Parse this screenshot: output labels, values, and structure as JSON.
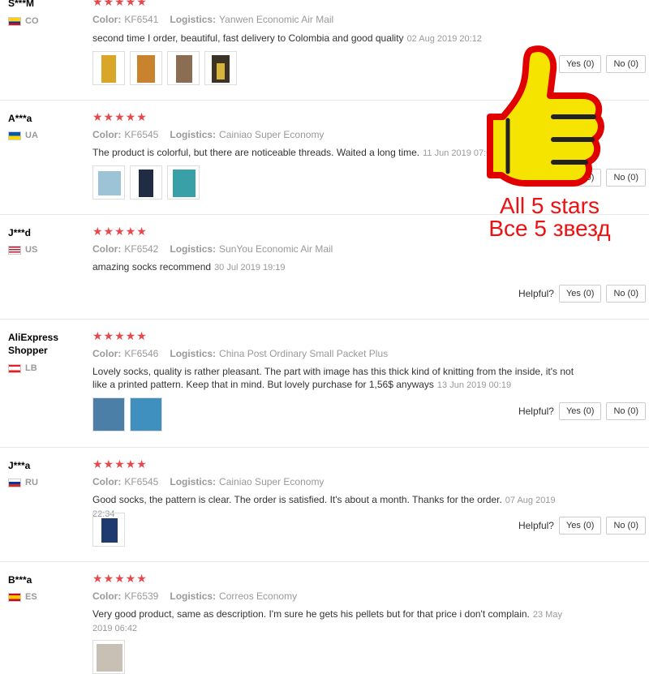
{
  "labels": {
    "color": "Color:",
    "logistics": "Logistics:",
    "helpful": "Helpful?"
  },
  "reviews": [
    {
      "user": "S***M",
      "country": "CO",
      "color_code": "KF6541",
      "logistics": "Yanwen Economic Air Mail",
      "text": "second time I order, beautiful, fast delivery to Colombia and good quality",
      "date": "02 Aug 2019 20:12",
      "yes": "Yes (0)",
      "no": "No (0)",
      "stars": "★★★★★"
    },
    {
      "user": "A***a",
      "country": "UA",
      "color_code": "KF6545",
      "logistics": "Cainiao Super Economy",
      "text": "The product is colorful, but there are noticeable threads. Waited a long time.",
      "date": "11 Jun 2019 07:03",
      "yes": "Yes (0)",
      "no": "No (0)",
      "stars": "★★★★★"
    },
    {
      "user": "J***d",
      "country": "US",
      "color_code": "KF6542",
      "logistics": "SunYou Economic Air Mail",
      "text": "amazing socks recommend",
      "date": "30 Jul 2019 19:19",
      "yes": "Yes (0)",
      "no": "No (0)",
      "stars": "★★★★★"
    },
    {
      "user": "AliExpress Shopper",
      "country": "LB",
      "color_code": "KF6546",
      "logistics": "China Post Ordinary Small Packet Plus",
      "text": "Lovely socks, quality is rather pleasant. The part with image has this thick kind of knitting from the inside, it's not like a printed pattern. Keep that in mind. But lovely purchase for 1,56$ anyways",
      "date": "13 Jun 2019 00:19",
      "yes": "Yes (0)",
      "no": "No (0)",
      "stars": "★★★★★"
    },
    {
      "user": "J***a",
      "country": "RU",
      "color_code": "KF6545",
      "logistics": "Cainiao Super Economy",
      "text": "Good socks, the pattern is clear. The order is satisfied. It's about a month. Thanks for the order.",
      "date": "07 Aug 2019 22:34",
      "yes": "Yes (0)",
      "no": "No (0)",
      "stars": "★★★★★"
    },
    {
      "user": "B***a",
      "country": "ES",
      "color_code": "KF6539",
      "logistics": "Correos Economy",
      "text": "Very good product, same as description. I'm sure he gets his pellets but for that price i don't complain.",
      "date": "23 May 2019 06:42",
      "stars": "★★★★★"
    }
  ],
  "overlay": {
    "line1": "All 5 stars",
    "line2": "Все 5 звезд"
  },
  "colors": {
    "star": "#e5484d",
    "overlay_text": "#ee1111",
    "thumb_yellow": "#f5e400",
    "thumb_outline": "#e00000"
  }
}
